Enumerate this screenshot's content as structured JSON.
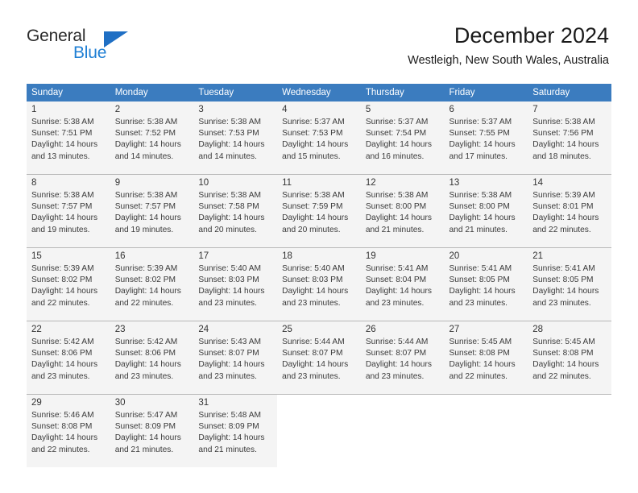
{
  "brand": {
    "name_part1": "General",
    "name_part2": "Blue",
    "logo_icon": "triangle-logo-icon"
  },
  "header": {
    "month_title": "December 2024",
    "location": "Westleigh, New South Wales, Australia"
  },
  "colors": {
    "header_row_bg": "#3b7cbf",
    "header_row_text": "#ffffff",
    "cell_shade": "#f4f4f4",
    "brand_blue": "#1f7fd4",
    "grid_line": "#b8b8b8"
  },
  "weekday_headers": [
    "Sunday",
    "Monday",
    "Tuesday",
    "Wednesday",
    "Thursday",
    "Friday",
    "Saturday"
  ],
  "weeks": [
    [
      {
        "day": "1",
        "sunrise": "Sunrise: 5:38 AM",
        "sunset": "Sunset: 7:51 PM",
        "daylight1": "Daylight: 14 hours",
        "daylight2": "and 13 minutes."
      },
      {
        "day": "2",
        "sunrise": "Sunrise: 5:38 AM",
        "sunset": "Sunset: 7:52 PM",
        "daylight1": "Daylight: 14 hours",
        "daylight2": "and 14 minutes."
      },
      {
        "day": "3",
        "sunrise": "Sunrise: 5:38 AM",
        "sunset": "Sunset: 7:53 PM",
        "daylight1": "Daylight: 14 hours",
        "daylight2": "and 14 minutes."
      },
      {
        "day": "4",
        "sunrise": "Sunrise: 5:37 AM",
        "sunset": "Sunset: 7:53 PM",
        "daylight1": "Daylight: 14 hours",
        "daylight2": "and 15 minutes."
      },
      {
        "day": "5",
        "sunrise": "Sunrise: 5:37 AM",
        "sunset": "Sunset: 7:54 PM",
        "daylight1": "Daylight: 14 hours",
        "daylight2": "and 16 minutes."
      },
      {
        "day": "6",
        "sunrise": "Sunrise: 5:37 AM",
        "sunset": "Sunset: 7:55 PM",
        "daylight1": "Daylight: 14 hours",
        "daylight2": "and 17 minutes."
      },
      {
        "day": "7",
        "sunrise": "Sunrise: 5:38 AM",
        "sunset": "Sunset: 7:56 PM",
        "daylight1": "Daylight: 14 hours",
        "daylight2": "and 18 minutes."
      }
    ],
    [
      {
        "day": "8",
        "sunrise": "Sunrise: 5:38 AM",
        "sunset": "Sunset: 7:57 PM",
        "daylight1": "Daylight: 14 hours",
        "daylight2": "and 19 minutes."
      },
      {
        "day": "9",
        "sunrise": "Sunrise: 5:38 AM",
        "sunset": "Sunset: 7:57 PM",
        "daylight1": "Daylight: 14 hours",
        "daylight2": "and 19 minutes."
      },
      {
        "day": "10",
        "sunrise": "Sunrise: 5:38 AM",
        "sunset": "Sunset: 7:58 PM",
        "daylight1": "Daylight: 14 hours",
        "daylight2": "and 20 minutes."
      },
      {
        "day": "11",
        "sunrise": "Sunrise: 5:38 AM",
        "sunset": "Sunset: 7:59 PM",
        "daylight1": "Daylight: 14 hours",
        "daylight2": "and 20 minutes."
      },
      {
        "day": "12",
        "sunrise": "Sunrise: 5:38 AM",
        "sunset": "Sunset: 8:00 PM",
        "daylight1": "Daylight: 14 hours",
        "daylight2": "and 21 minutes."
      },
      {
        "day": "13",
        "sunrise": "Sunrise: 5:38 AM",
        "sunset": "Sunset: 8:00 PM",
        "daylight1": "Daylight: 14 hours",
        "daylight2": "and 21 minutes."
      },
      {
        "day": "14",
        "sunrise": "Sunrise: 5:39 AM",
        "sunset": "Sunset: 8:01 PM",
        "daylight1": "Daylight: 14 hours",
        "daylight2": "and 22 minutes."
      }
    ],
    [
      {
        "day": "15",
        "sunrise": "Sunrise: 5:39 AM",
        "sunset": "Sunset: 8:02 PM",
        "daylight1": "Daylight: 14 hours",
        "daylight2": "and 22 minutes."
      },
      {
        "day": "16",
        "sunrise": "Sunrise: 5:39 AM",
        "sunset": "Sunset: 8:02 PM",
        "daylight1": "Daylight: 14 hours",
        "daylight2": "and 22 minutes."
      },
      {
        "day": "17",
        "sunrise": "Sunrise: 5:40 AM",
        "sunset": "Sunset: 8:03 PM",
        "daylight1": "Daylight: 14 hours",
        "daylight2": "and 23 minutes."
      },
      {
        "day": "18",
        "sunrise": "Sunrise: 5:40 AM",
        "sunset": "Sunset: 8:03 PM",
        "daylight1": "Daylight: 14 hours",
        "daylight2": "and 23 minutes."
      },
      {
        "day": "19",
        "sunrise": "Sunrise: 5:41 AM",
        "sunset": "Sunset: 8:04 PM",
        "daylight1": "Daylight: 14 hours",
        "daylight2": "and 23 minutes."
      },
      {
        "day": "20",
        "sunrise": "Sunrise: 5:41 AM",
        "sunset": "Sunset: 8:05 PM",
        "daylight1": "Daylight: 14 hours",
        "daylight2": "and 23 minutes."
      },
      {
        "day": "21",
        "sunrise": "Sunrise: 5:41 AM",
        "sunset": "Sunset: 8:05 PM",
        "daylight1": "Daylight: 14 hours",
        "daylight2": "and 23 minutes."
      }
    ],
    [
      {
        "day": "22",
        "sunrise": "Sunrise: 5:42 AM",
        "sunset": "Sunset: 8:06 PM",
        "daylight1": "Daylight: 14 hours",
        "daylight2": "and 23 minutes."
      },
      {
        "day": "23",
        "sunrise": "Sunrise: 5:42 AM",
        "sunset": "Sunset: 8:06 PM",
        "daylight1": "Daylight: 14 hours",
        "daylight2": "and 23 minutes."
      },
      {
        "day": "24",
        "sunrise": "Sunrise: 5:43 AM",
        "sunset": "Sunset: 8:07 PM",
        "daylight1": "Daylight: 14 hours",
        "daylight2": "and 23 minutes."
      },
      {
        "day": "25",
        "sunrise": "Sunrise: 5:44 AM",
        "sunset": "Sunset: 8:07 PM",
        "daylight1": "Daylight: 14 hours",
        "daylight2": "and 23 minutes."
      },
      {
        "day": "26",
        "sunrise": "Sunrise: 5:44 AM",
        "sunset": "Sunset: 8:07 PM",
        "daylight1": "Daylight: 14 hours",
        "daylight2": "and 23 minutes."
      },
      {
        "day": "27",
        "sunrise": "Sunrise: 5:45 AM",
        "sunset": "Sunset: 8:08 PM",
        "daylight1": "Daylight: 14 hours",
        "daylight2": "and 22 minutes."
      },
      {
        "day": "28",
        "sunrise": "Sunrise: 5:45 AM",
        "sunset": "Sunset: 8:08 PM",
        "daylight1": "Daylight: 14 hours",
        "daylight2": "and 22 minutes."
      }
    ],
    [
      {
        "day": "29",
        "sunrise": "Sunrise: 5:46 AM",
        "sunset": "Sunset: 8:08 PM",
        "daylight1": "Daylight: 14 hours",
        "daylight2": "and 22 minutes."
      },
      {
        "day": "30",
        "sunrise": "Sunrise: 5:47 AM",
        "sunset": "Sunset: 8:09 PM",
        "daylight1": "Daylight: 14 hours",
        "daylight2": "and 21 minutes."
      },
      {
        "day": "31",
        "sunrise": "Sunrise: 5:48 AM",
        "sunset": "Sunset: 8:09 PM",
        "daylight1": "Daylight: 14 hours",
        "daylight2": "and 21 minutes."
      },
      null,
      null,
      null,
      null
    ]
  ]
}
